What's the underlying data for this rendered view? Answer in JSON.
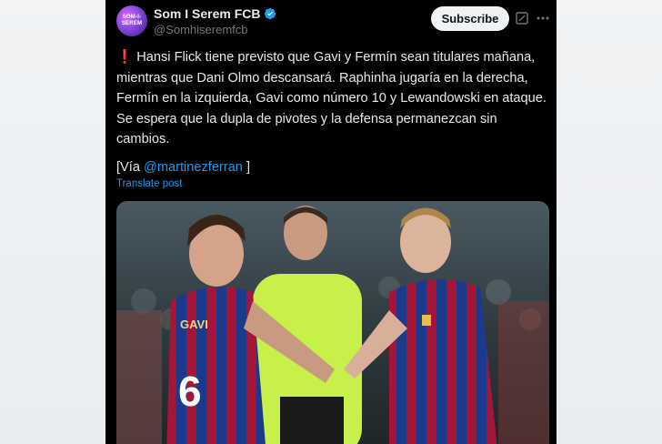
{
  "account": {
    "avatar_text_1": "SOM-I-",
    "avatar_text_2": "SEREM",
    "display_name": "Som I Serem FCB",
    "handle": "@Somhiseremfcb"
  },
  "actions": {
    "subscribe_label": "Subscribe"
  },
  "post": {
    "alert_glyph": "❗",
    "text": "Hansi Flick tiene previsto que Gavi y Fermín sean titulares mañana,\nmientras que Dani Olmo descansará. Raphinha jugaría en la derecha,\nFermín en la izquierda, Gavi como número 10 y Lewandowski en ataque.\nSe espera que la dupla de pivotes y la defensa permanezcan sin\ncambios.",
    "via_prefix": "[Vía",
    "via_mention": "@martinezferran",
    "via_suffix": " ]",
    "translate_label": "Translate post"
  },
  "photo": {
    "left_player_shirt_name": "GAVI",
    "left_player_shirt_number": "6"
  },
  "colors": {
    "background": "#000000",
    "accent_link": "#1d9bf0",
    "verified": "#1d9bf0",
    "barca_blue": "#1c3a8c",
    "barca_red": "#a3163a",
    "referee_shirt": "#c8f04a"
  }
}
